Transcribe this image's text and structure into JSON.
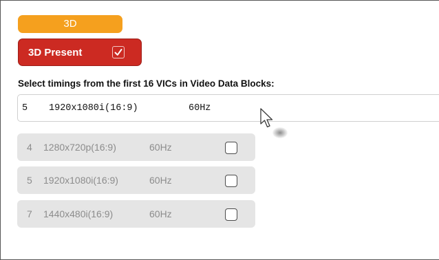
{
  "tab": {
    "label": "3D"
  },
  "present": {
    "label": "3D Present",
    "checked": true
  },
  "heading": "Select timings from the first 16 VICs in Video Data Blocks:",
  "selected": {
    "number": "5",
    "resolution": "1920x1080i(16:9)",
    "rate": "60Hz"
  },
  "timings": [
    {
      "number": "4",
      "resolution": "1280x720p(16:9)",
      "rate": "60Hz",
      "checked": false
    },
    {
      "number": "5",
      "resolution": "1920x1080i(16:9)",
      "rate": "60Hz",
      "checked": false
    },
    {
      "number": "7",
      "resolution": "1440x480i(16:9)",
      "rate": "60Hz",
      "checked": false
    }
  ],
  "colors": {
    "tab": "#f5a01e",
    "present_button": "#cc2a22",
    "row_background": "#e5e5e5",
    "row_text": "#8c8c8c"
  },
  "icons": {
    "present_checkbox": "checkmark-icon",
    "cursor": "mouse-pointer-icon"
  }
}
